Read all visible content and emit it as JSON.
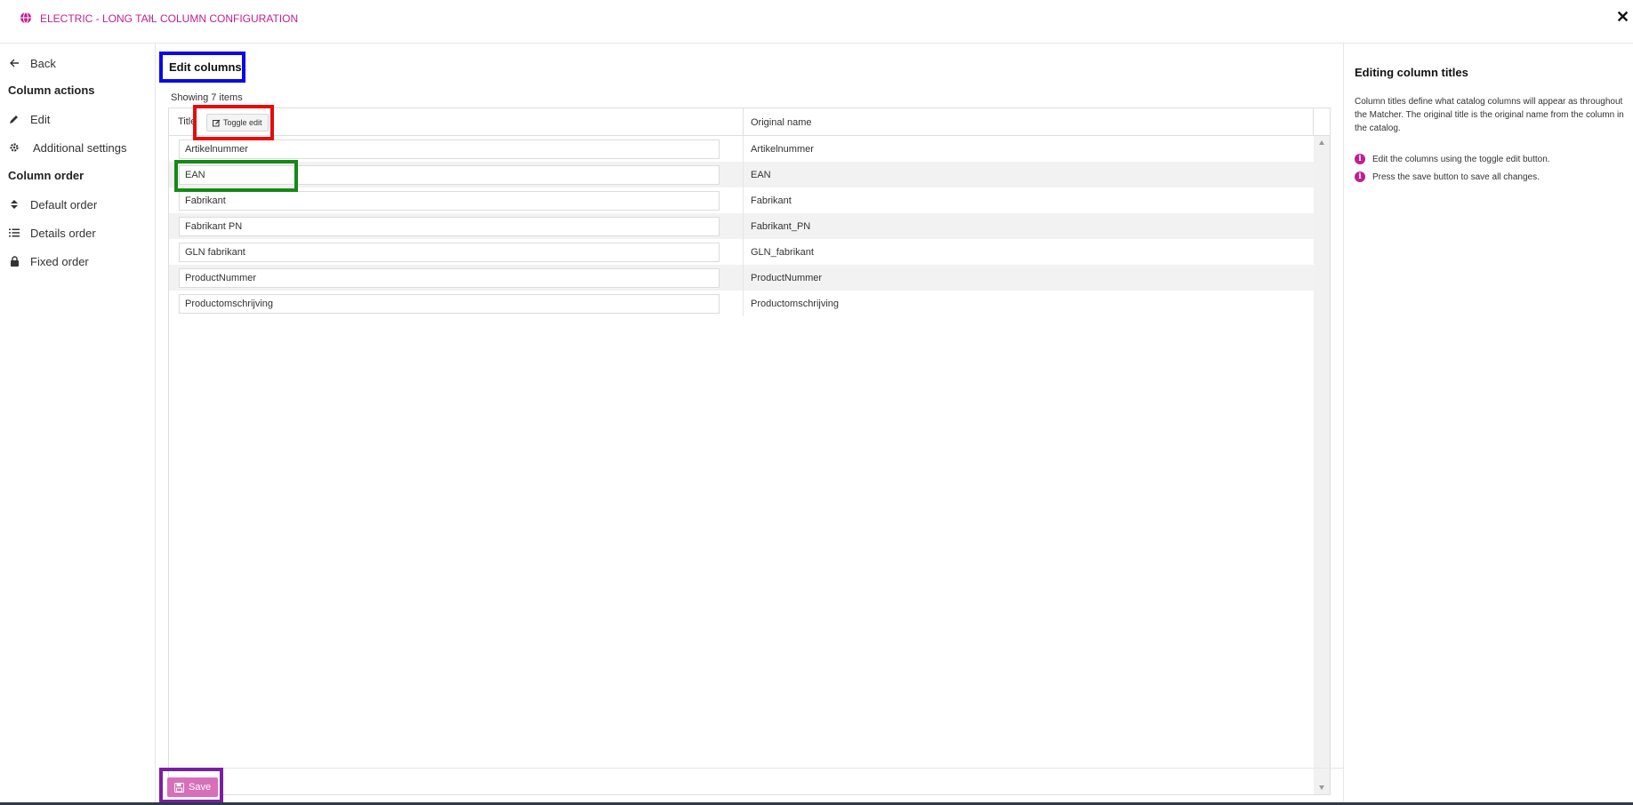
{
  "breadcrumb": {
    "icon": "globe-icon",
    "items": [
      "ELECTRIC - LONG TAIL",
      "COLUMN CONFIGURATION"
    ],
    "separator": ">"
  },
  "close_label": "✕",
  "sidebar": {
    "back_label": "Back",
    "column_actions_heading": "Column actions",
    "actions": [
      {
        "label": "Edit",
        "icon": "pencil-icon"
      },
      {
        "label": "Additional settings",
        "icon": "gear-icon"
      }
    ],
    "column_order_heading": "Column order",
    "orders": [
      {
        "label": "Default order",
        "icon": "sort-icon"
      },
      {
        "label": "Details order",
        "icon": "list-icon"
      },
      {
        "label": "Fixed order",
        "icon": "lock-icon"
      }
    ]
  },
  "main": {
    "title": "Edit columns",
    "showing_text": "Showing 7 items",
    "columns": {
      "title": "Title",
      "original": "Original name"
    },
    "toggle_edit_label": "Toggle edit",
    "rows": [
      {
        "title": "Artikelnummer",
        "original": "Artikelnummer"
      },
      {
        "title": "EAN",
        "original": "EAN"
      },
      {
        "title": "Fabrikant",
        "original": "Fabrikant"
      },
      {
        "title": "Fabrikant PN",
        "original": "Fabrikant_PN"
      },
      {
        "title": "GLN fabrikant",
        "original": "GLN_fabrikant"
      },
      {
        "title": "ProductNummer",
        "original": "ProductNummer"
      },
      {
        "title": "Productomschrijving",
        "original": "Productomschrijving"
      }
    ],
    "save_label": "Save"
  },
  "help_panel": {
    "title": "Editing column titles",
    "description": "Column titles define what catalog columns will appear as throughout the Matcher. The original title is the original name from the column in the catalog.",
    "tips": [
      "Edit the columns using the toggle edit button.",
      "Press the save button to save all changes."
    ]
  },
  "colors": {
    "accent": "#c21e8f",
    "save_button": "#d86fb9",
    "highlight_blue": "#0a0ae6",
    "highlight_red": "#e60c0c",
    "highlight_green": "#148a14",
    "highlight_purple": "#7b1fa2"
  }
}
